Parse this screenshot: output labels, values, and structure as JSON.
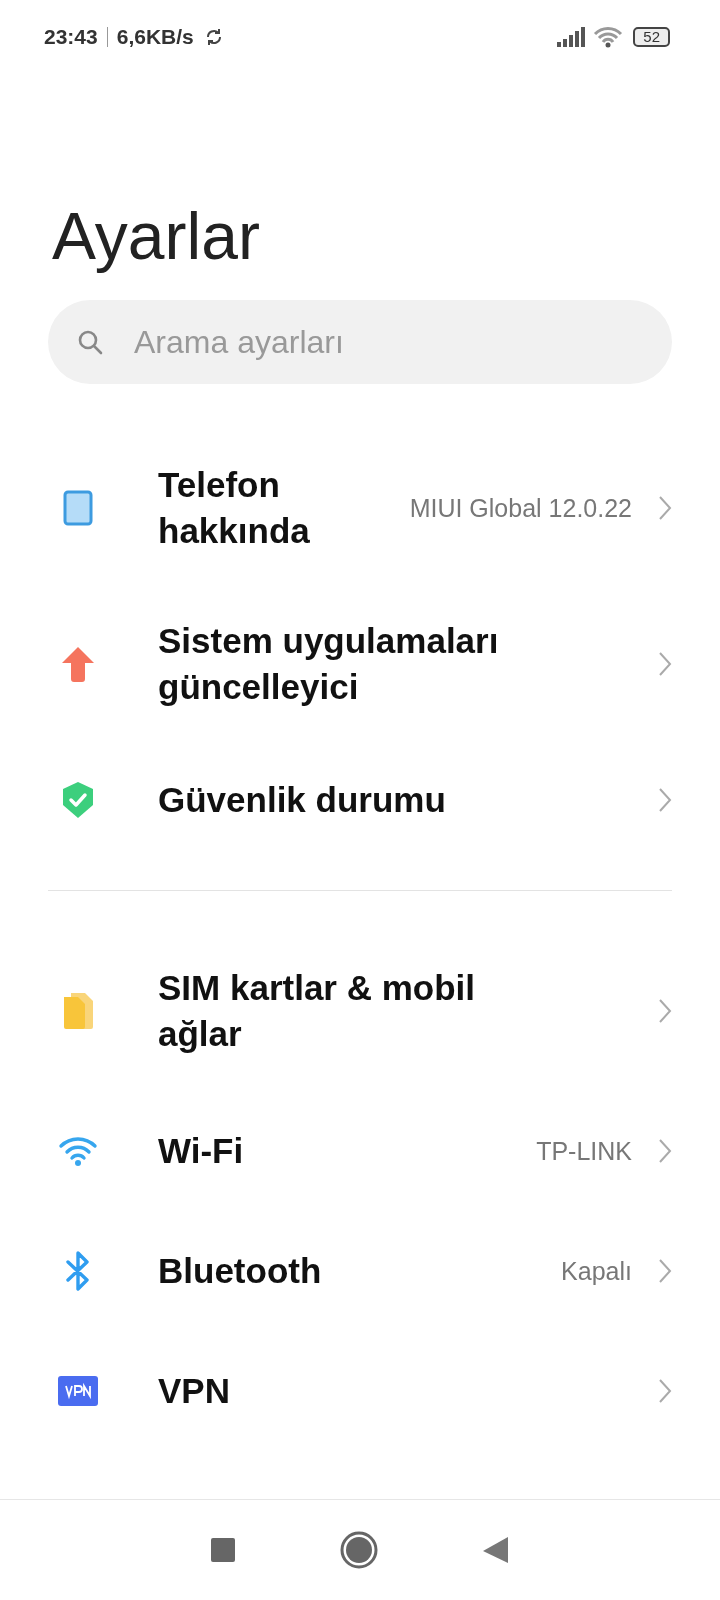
{
  "status_bar": {
    "time": "23:43",
    "speed": "6,6KB/s",
    "battery": "52"
  },
  "title": "Ayarlar",
  "search": {
    "placeholder": "Arama ayarları"
  },
  "sections": [
    {
      "items": [
        {
          "kind": "phone",
          "label": "Telefon hakkında",
          "value": "MIUI Global 12.0.22"
        },
        {
          "kind": "update",
          "label": "Sistem uygulamaları güncelleyici"
        },
        {
          "kind": "security",
          "label": "Güvenlik durumu"
        }
      ]
    },
    {
      "items": [
        {
          "kind": "sim",
          "label": "SIM kartlar & mobil ağlar"
        },
        {
          "kind": "wifi",
          "label": "Wi-Fi",
          "value": "TP-LINK"
        },
        {
          "kind": "bluetooth",
          "label": "Bluetooth",
          "value": "Kapalı"
        },
        {
          "kind": "vpn",
          "label": "VPN"
        }
      ]
    }
  ]
}
